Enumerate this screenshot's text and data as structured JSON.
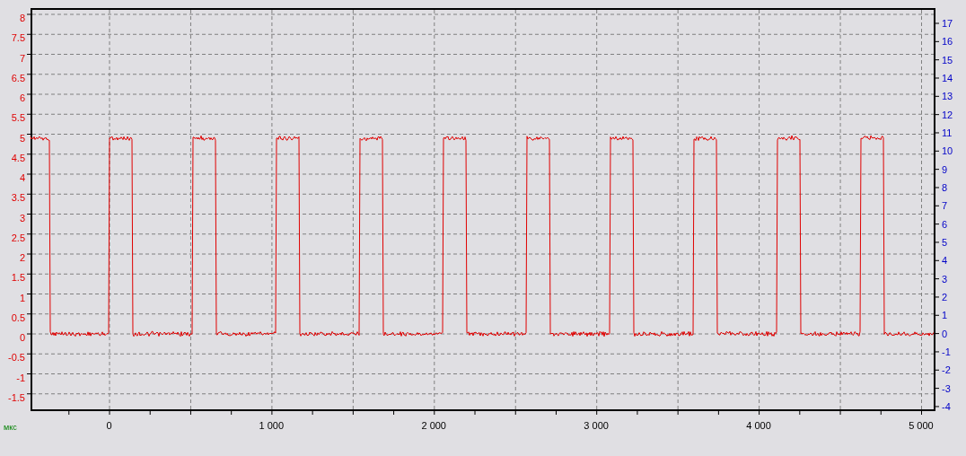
{
  "chart": {
    "left_axis": {
      "labels": [
        "8",
        "7.5",
        "7",
        "6.5",
        "6",
        "5.5",
        "5",
        "4.5",
        "4",
        "3.5",
        "3",
        "2.5",
        "2",
        "1.5",
        "1",
        "0.5",
        "0",
        "-0.5",
        "-1",
        "-1.5"
      ]
    },
    "right_axis": {
      "labels": [
        "17",
        "16",
        "15",
        "14",
        "13",
        "12",
        "11",
        "10",
        "9",
        "8",
        "7",
        "6",
        "5",
        "4",
        "3",
        "2",
        "1",
        "0",
        "-1",
        "-2",
        "-3",
        "-4"
      ]
    },
    "x_axis": {
      "unit": "мкс",
      "labels": [
        "0",
        "1 000",
        "2 000",
        "3 000",
        "4 000",
        "5 000"
      ]
    }
  }
}
